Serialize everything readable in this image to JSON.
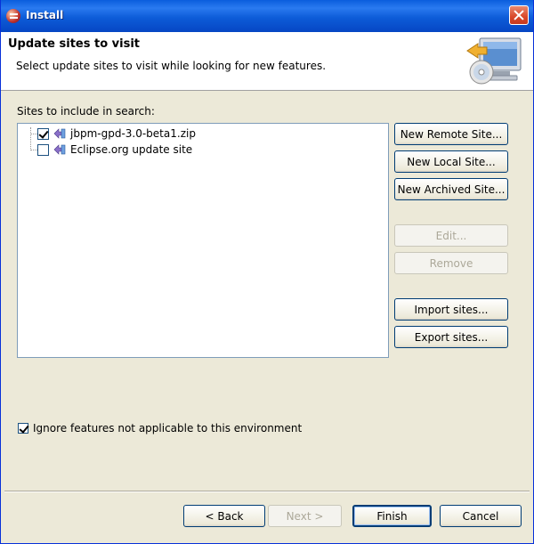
{
  "window": {
    "title": "Install"
  },
  "header": {
    "title": "Update sites to visit",
    "description": "Select update sites to visit while looking for new features.",
    "icon": "install-wizard-icon"
  },
  "sites": {
    "label": "Sites to include in search:",
    "items": [
      {
        "label": "jbpm-gpd-3.0-beta1.zip",
        "checked": true,
        "icon": "archive-site-icon"
      },
      {
        "label": "Eclipse.org update site",
        "checked": false,
        "icon": "remote-site-icon"
      }
    ]
  },
  "side_buttons": {
    "new_remote": "New Remote Site...",
    "new_local": "New Local Site...",
    "new_archived": "New Archived Site...",
    "edit": "Edit...",
    "remove": "Remove",
    "import": "Import sites...",
    "export": "Export sites..."
  },
  "options": {
    "ignore_label": "Ignore features not applicable to this environment",
    "ignore_checked": true
  },
  "footer": {
    "back": "< Back",
    "next": "Next >",
    "finish": "Finish",
    "cancel": "Cancel"
  },
  "colors": {
    "titlebar": "#0a5ddd",
    "dialog_bg": "#ece9d8",
    "disabled_text": "#aca899"
  }
}
